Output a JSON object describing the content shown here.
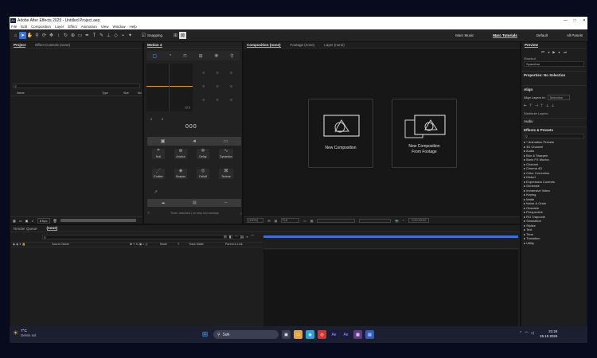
{
  "window": {
    "title": "Adobe After Effects 2025 - Untitled Project.aep",
    "app_icon": "Ae",
    "controls": [
      "—",
      "□",
      "✕"
    ]
  },
  "menu": [
    "File",
    "Edit",
    "Composition",
    "Layer",
    "Effect",
    "Animation",
    "View",
    "Window",
    "Help"
  ],
  "toolbar": {
    "snapping_label": "Snapping",
    "workspaces": [
      "Marc Music",
      "Marc Tutorials",
      "Default",
      "All Panels"
    ],
    "active_workspace_index": 1
  },
  "project_panel": {
    "tabs": [
      "Project",
      "Effect Controls (none)"
    ],
    "search_placeholder": "",
    "columns": [
      "Name",
      "Type",
      "Size",
      "Mu"
    ],
    "bpc": "8 bpc"
  },
  "motion_panel": {
    "title": "Motion 4",
    "digits": "000",
    "field_left": "0",
    "field_mid": "0",
    "buttons": [
      "Null",
      "Anchor",
      "Delay",
      "Dynamics",
      "Emitter",
      "Shapes",
      "Falloff",
      "Texture"
    ],
    "status": "Tools: unlocked | no stop tool overlays"
  },
  "composition_panel": {
    "tabs": [
      "Composition (none)",
      "Footage (none)",
      "Layer (none)"
    ],
    "new_comp": "New Composition",
    "new_from_footage_1": "New Composition",
    "new_from_footage_2": "From Footage",
    "zoom": "(100%)",
    "resolution": "Full",
    "timecode": "0:00:00:00"
  },
  "right_panel": {
    "preview_title": "Preview",
    "shortcut_label": "Shortcut",
    "shortcut_value": "Spacebar",
    "properties_title": "Properties: No Selection",
    "align_title": "Align",
    "align_layers_to": "Align Layers to:",
    "align_value": "Selection",
    "distribute_label": "Distribute Layers:",
    "audio_label": "Audio",
    "effects_title": "Effects & Presets",
    "effects": [
      "* Animation Presets",
      "3D Channel",
      "Audio",
      "Blur & Sharpen",
      "Boris FX Mocha",
      "Channel",
      "Cinema 4D",
      "Color Correction",
      "Distort",
      "Expression Controls",
      "Generate",
      "Immersive Video",
      "Keying",
      "Matte",
      "Noise & Grain",
      "Obsolete",
      "Perspective",
      "RG Trapcode",
      "Simulation",
      "Stylize",
      "Text",
      "Time",
      "Transition",
      "Utility"
    ]
  },
  "timeline": {
    "tabs": [
      "Render Queue",
      "(none)"
    ],
    "columns": [
      "Source Name",
      "Mode",
      "T",
      "Track Matte",
      "Parent & Link"
    ],
    "footer": "Frame Render Time:",
    "footer_value": "0ms"
  },
  "taskbar": {
    "weather_temp": "7°C",
    "weather_text": "Delvis sol",
    "search_placeholder": "Søk",
    "time": "21:24",
    "date": "15.10.2024"
  },
  "colors": {
    "accent": "#3a6fd8",
    "taskbar": "#1b1f30",
    "desktop": "#080a1e"
  }
}
